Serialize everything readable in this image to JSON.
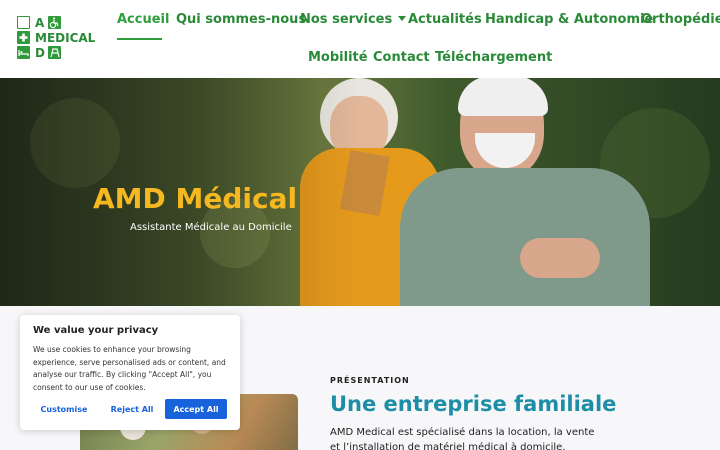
{
  "logo": {
    "letters": [
      "A",
      "MEDICAL",
      "D"
    ]
  },
  "nav": {
    "items": [
      {
        "label": "Accueil"
      },
      {
        "label": "Qui sommes-nous"
      },
      {
        "label": "Nos services"
      },
      {
        "label": "Actualités"
      },
      {
        "label": "Handicap & Autonomie"
      },
      {
        "label": "Orthopédie"
      },
      {
        "label": "Mobilité"
      },
      {
        "label": "Contact"
      },
      {
        "label": "Téléchargement"
      }
    ],
    "active_index": 0
  },
  "hero": {
    "title": "AMD Médical",
    "subtitle": "Assistante Médicale au Domicile"
  },
  "presentation": {
    "eyebrow": "PRÉSENTATION",
    "title": "Une entreprise familiale",
    "body": "AMD Medical est spécialisé dans la location, la vente et l’installation de matériel médical à domicile."
  },
  "cookie": {
    "title": "We value your privacy",
    "text": "We use cookies to enhance your browsing experience, serve personalised ads or content, and analyse our traffic. By clicking \"Accept All\", you consent to our use of cookies.",
    "customise_label": "Customise",
    "reject_label": "Reject All",
    "accept_label": "Accept All"
  },
  "colors": {
    "brand_green": "#2a8a38",
    "hero_title": "#f5b820",
    "section_title": "#1d8ea5",
    "cookie_accent": "#1863dc"
  }
}
